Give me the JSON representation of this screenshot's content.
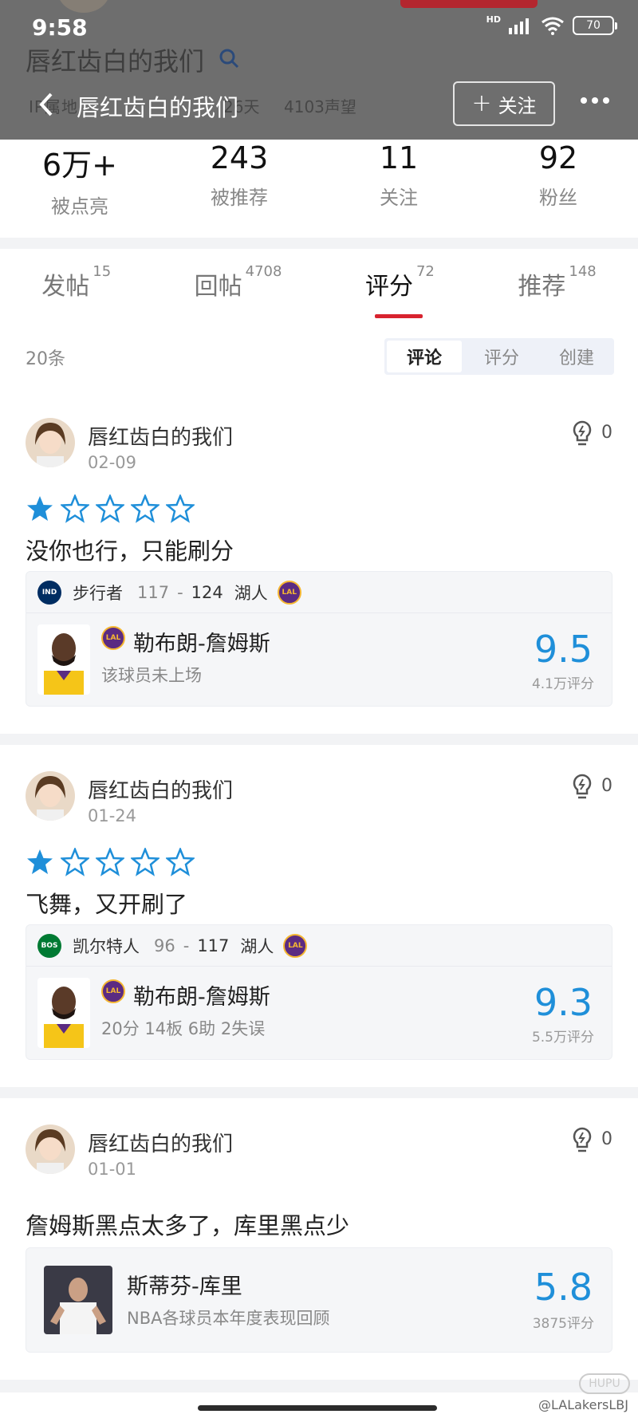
{
  "status_bar": {
    "time": "9:58",
    "network": "HD",
    "battery": "70"
  },
  "profile": {
    "name": "唇红齿白的我们",
    "ip_label": "IP属地",
    "days": "26天",
    "reputation": "4103声望"
  },
  "navbar": {
    "title": "唇红齿白的我们",
    "follow_label": "关注"
  },
  "stats": [
    {
      "value": "6万+",
      "label": "被点亮"
    },
    {
      "value": "243",
      "label": "被推荐"
    },
    {
      "value": "11",
      "label": "关注"
    },
    {
      "value": "92",
      "label": "粉丝"
    }
  ],
  "tabs": [
    {
      "label": "发帖",
      "count": "15",
      "active": false
    },
    {
      "label": "回帖",
      "count": "4708",
      "active": false
    },
    {
      "label": "评分",
      "count": "72",
      "active": true
    },
    {
      "label": "推荐",
      "count": "148",
      "active": false
    }
  ],
  "filter": {
    "count_label": "20条",
    "segments": [
      {
        "label": "评论",
        "active": true
      },
      {
        "label": "评分",
        "active": false
      },
      {
        "label": "创建",
        "active": false
      }
    ]
  },
  "cards": [
    {
      "user": "唇红齿白的我们",
      "date": "02-09",
      "light_count": "0",
      "rating_stars": 1,
      "comment": "没你也行，只能刷分",
      "game": {
        "team_a": "步行者",
        "team_a_code": "IND",
        "score_a": "117",
        "score_b": "124",
        "team_b": "湖人",
        "team_b_code": "LAL"
      },
      "player": {
        "name": "勒布朗-詹姆斯",
        "team_code": "LAL",
        "subtitle": "该球员未上场",
        "score": "9.5",
        "rating_count": "4.1万评分"
      }
    },
    {
      "user": "唇红齿白的我们",
      "date": "01-24",
      "light_count": "0",
      "rating_stars": 1,
      "comment": "飞舞，又开刷了",
      "game": {
        "team_a": "凯尔特人",
        "team_a_code": "BOS",
        "score_a": "96",
        "score_b": "117",
        "team_b": "湖人",
        "team_b_code": "LAL"
      },
      "player": {
        "name": "勒布朗-詹姆斯",
        "team_code": "LAL",
        "subtitle": "20分 14板 6助 2失误",
        "score": "9.3",
        "rating_count": "5.5万评分"
      }
    },
    {
      "user": "唇红齿白的我们",
      "date": "01-01",
      "light_count": "0",
      "comment": "詹姆斯黑点太多了，库里黑点少",
      "player": {
        "name": "斯蒂芬-库里",
        "subtitle": "NBA各球员本年度表现回顾",
        "score": "5.8",
        "rating_count": "3875评分"
      }
    }
  ],
  "watermark": "@LALakersLBJ",
  "watermark_logo": "HUPU",
  "colors": {
    "accent_red": "#d8232f",
    "score_blue": "#1f8fd9",
    "star_blue": "#1f8fd9",
    "lakers_purple": "#5b2b82",
    "lakers_gold": "#f5b731",
    "pacers_navy": "#002d62",
    "celtics_green": "#007a33"
  }
}
